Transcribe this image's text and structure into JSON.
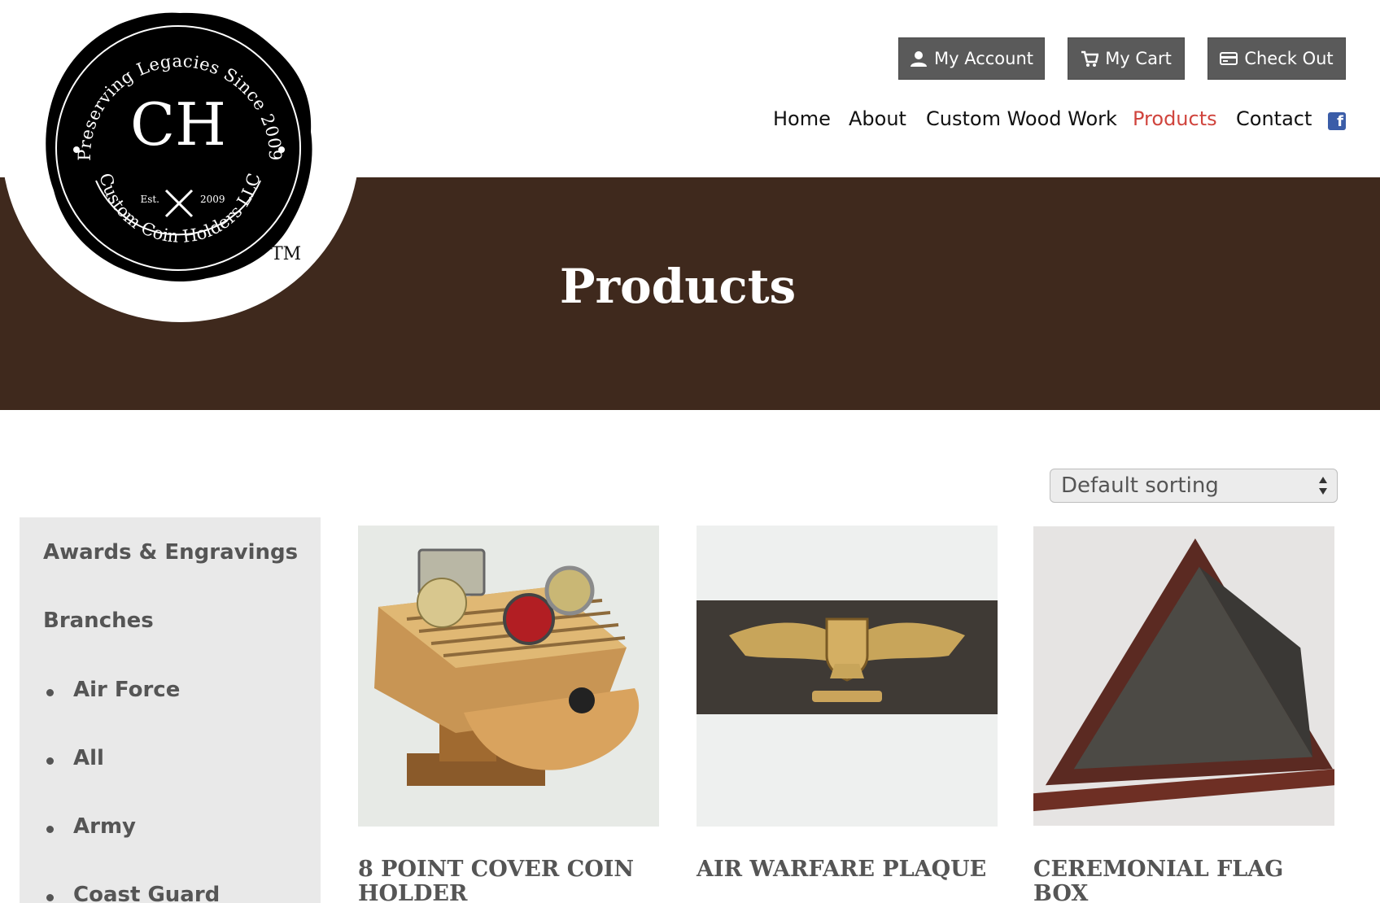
{
  "header": {
    "account_label": "My Account",
    "cart_label": "My Cart",
    "checkout_label": "Check Out"
  },
  "nav": {
    "items": [
      "Home",
      "About",
      "Custom Wood Work",
      "Products",
      "Contact"
    ],
    "active": "Products"
  },
  "logo": {
    "arc_top": "Preserving Legacies Since 2009",
    "monogram": "CH",
    "est": "Est.",
    "year": "2009",
    "arc_bottom": "Custom Coin Holders LLC",
    "tm": "TM"
  },
  "hero": {
    "title": "Products"
  },
  "sorting": {
    "selected": "Default sorting"
  },
  "sidebar": {
    "headings": [
      "Awards & Engravings",
      "Branches"
    ],
    "items": [
      "Air Force",
      "All",
      "Army",
      "Coast Guard"
    ]
  },
  "products": [
    {
      "title_line1": "8 POINT COVER COIN",
      "title_line2": "HOLDER"
    },
    {
      "title_line1": "AIR WARFARE PLAQUE"
    },
    {
      "title_line1": "CEREMONIAL FLAG BOX"
    }
  ],
  "colors": {
    "button_bg": "#5a5a5a",
    "nav_active": "#d0443d",
    "hero_wood": "#3f291d",
    "sidebar_bg": "#e9e9e9",
    "facebook": "#3b5da8"
  }
}
